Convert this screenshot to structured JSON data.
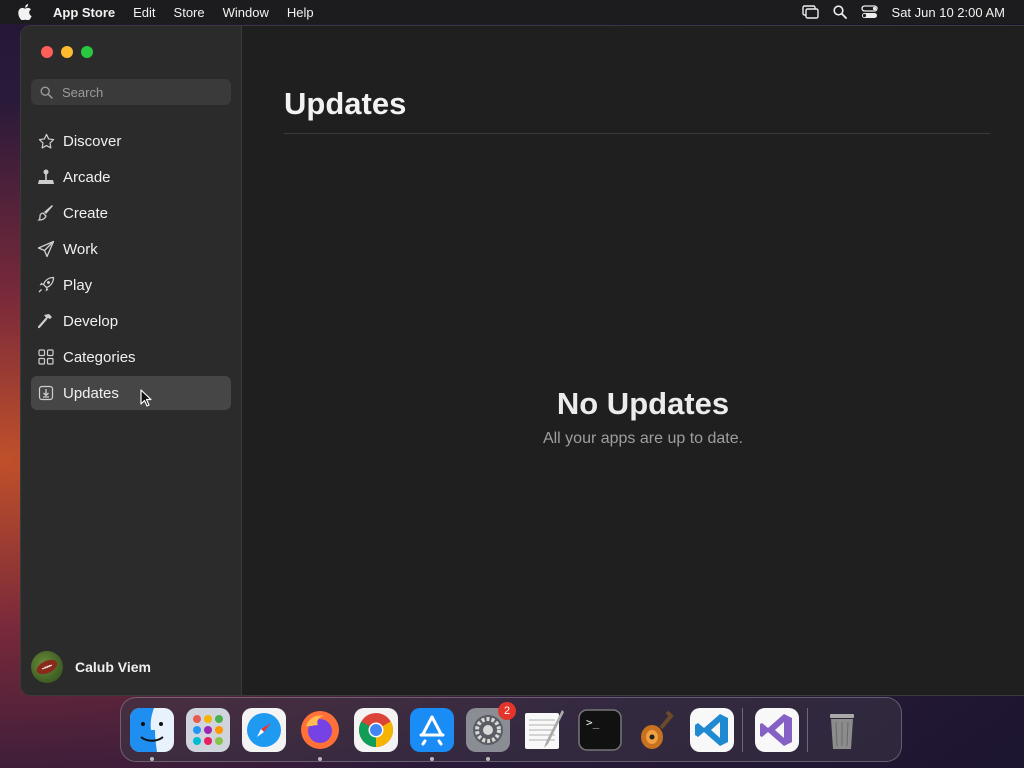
{
  "menubar": {
    "app_name": "App Store",
    "items": [
      "Edit",
      "Store",
      "Window",
      "Help"
    ],
    "datetime": "Sat Jun 10  2:00 AM"
  },
  "sidebar": {
    "search_placeholder": "Search",
    "items": [
      {
        "label": "Discover",
        "icon": "star-icon"
      },
      {
        "label": "Arcade",
        "icon": "joystick-icon"
      },
      {
        "label": "Create",
        "icon": "brush-icon"
      },
      {
        "label": "Work",
        "icon": "paper-plane-icon"
      },
      {
        "label": "Play",
        "icon": "rocket-icon"
      },
      {
        "label": "Develop",
        "icon": "hammer-icon"
      },
      {
        "label": "Categories",
        "icon": "grid-icon"
      },
      {
        "label": "Updates",
        "icon": "download-icon",
        "active": true
      }
    ],
    "user_name": "Calub Viem"
  },
  "main": {
    "title": "Updates",
    "empty_title": "No Updates",
    "empty_subtitle": "All your apps are up to date."
  },
  "dock": {
    "apps": [
      "Finder",
      "Launchpad",
      "Safari",
      "Firefox",
      "Chrome",
      "App Store",
      "System Settings",
      "TextEdit",
      "Terminal",
      "GarageBand",
      "Visual Studio Code",
      "Visual Studio",
      "Trash"
    ],
    "settings_badge": "2"
  }
}
